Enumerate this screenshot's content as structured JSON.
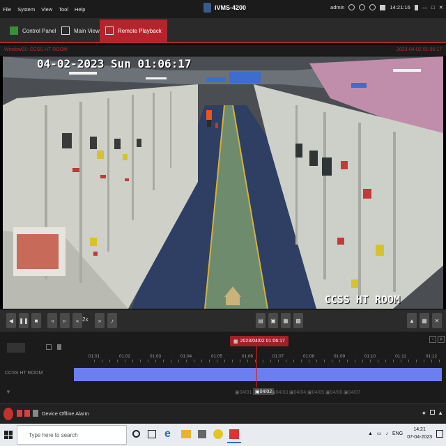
{
  "menu": [
    "File",
    "System",
    "View",
    "Tool",
    "Help"
  ],
  "app": {
    "title": "iVMS-4200",
    "user": "admin",
    "time": "14:21:16"
  },
  "tabs": [
    {
      "label": "Control Panel"
    },
    {
      "label": "Main View"
    },
    {
      "label": "Remote Playback"
    }
  ],
  "window": {
    "name": "Window01: CCSS HT ROOM",
    "timestamp": "2023-04-02 01:06:17"
  },
  "osd": {
    "datetime": "04-02-2023 Sun 01:06:17",
    "camera_name": "CCSS HT ROOM"
  },
  "controls": {
    "speed": "2x"
  },
  "timeline": {
    "current": "2023/04/02 01:06:17",
    "hours": [
      "01:01",
      "01:02",
      "01:03",
      "01:04",
      "01:05",
      "01:06",
      "01:07",
      "01:08",
      "01:09",
      "01:10",
      "01:11",
      "01:12"
    ],
    "track_label": "CCSS HT ROOM",
    "dates": [
      "04/01",
      "04/02",
      "04/03",
      "04/04",
      "04/05",
      "04/06",
      "04/07"
    ],
    "active_date": "04/02"
  },
  "alarm": {
    "text": "Device Offline Alarm"
  },
  "taskbar": {
    "search_placeholder": "Type here to search",
    "lang": "ENG",
    "time": "14:21",
    "date": "07-04-2023"
  }
}
